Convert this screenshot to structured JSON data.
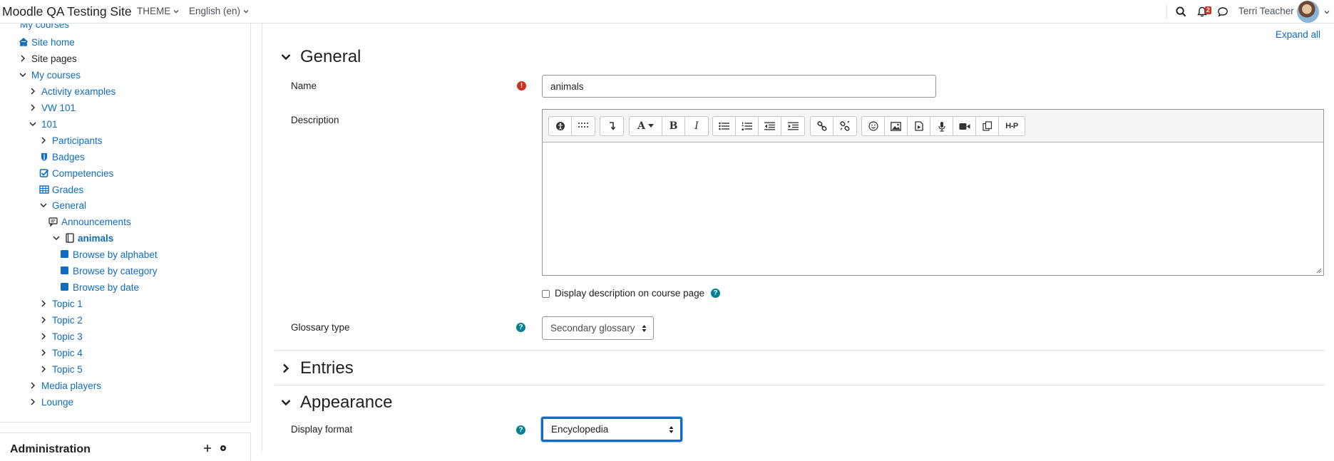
{
  "navbar": {
    "site_name": "Moodle QA Testing Site",
    "theme_label": "THEME",
    "language_label": "English (en)",
    "notification_count": "2",
    "user_name": "Terri Teacher"
  },
  "sidebar": {
    "items": [
      {
        "label": "My courses",
        "link": true
      },
      {
        "label": "Site home",
        "link": true,
        "icon": "home-icon"
      },
      {
        "label": "Site pages",
        "link": false
      },
      {
        "label": "My courses",
        "link": true
      },
      {
        "label": "Activity examples",
        "link": true
      },
      {
        "label": "VW 101",
        "link": true
      },
      {
        "label": "101",
        "link": true
      },
      {
        "label": "Participants",
        "link": true
      },
      {
        "label": "Badges",
        "link": true,
        "icon": "shield-icon"
      },
      {
        "label": "Competencies",
        "link": true,
        "icon": "checkbox-icon"
      },
      {
        "label": "Grades",
        "link": true,
        "icon": "table-icon"
      },
      {
        "label": "General",
        "link": true
      },
      {
        "label": "Announcements",
        "link": true,
        "icon": "forum-icon"
      },
      {
        "label": "animals",
        "link": true,
        "icon": "book-icon",
        "bold": true
      },
      {
        "label": "Browse by alphabet",
        "link": true,
        "icon": "square-icon"
      },
      {
        "label": "Browse by category",
        "link": true,
        "icon": "square-icon"
      },
      {
        "label": "Browse by date",
        "link": true,
        "icon": "square-icon"
      },
      {
        "label": "Topic 1",
        "link": true
      },
      {
        "label": "Topic 2",
        "link": true
      },
      {
        "label": "Topic 3",
        "link": true
      },
      {
        "label": "Topic 4",
        "link": true
      },
      {
        "label": "Topic 5",
        "link": true
      },
      {
        "label": "Media players",
        "link": true
      },
      {
        "label": "Lounge",
        "link": true
      }
    ],
    "admin_title": "Administration"
  },
  "main": {
    "expand_all": "Expand all",
    "general": {
      "title": "General",
      "name_label": "Name",
      "name_value": "animals",
      "description_label": "Description",
      "display_description_label": "Display description on course page",
      "glossary_type_label": "Glossary type",
      "glossary_type_value": "Secondary glossary"
    },
    "entries": {
      "title": "Entries"
    },
    "appearance": {
      "title": "Appearance",
      "display_format_label": "Display format",
      "display_format_value": "Encyclopedia"
    },
    "editor_toolbar": {
      "h5p_label": "H-P"
    }
  },
  "colors": {
    "link": "#0f6cbf",
    "required": "#ca3120",
    "help": "#008196",
    "focus": "#0f6cbf"
  }
}
